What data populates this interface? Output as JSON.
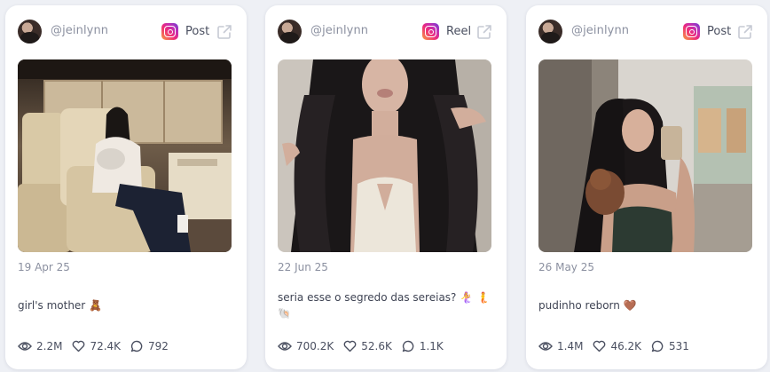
{
  "posts": [
    {
      "username": "@jeinlynn",
      "type": "Post",
      "date": "19 Apr 25",
      "caption": "girl's mother 🧸",
      "views": "2.2M",
      "likes": "72.4K",
      "comments": "792"
    },
    {
      "username": "@jeinlynn",
      "type": "Reel",
      "date": "22 Jun 25",
      "caption": "seria esse o segredo das sereias? 🧜‍♀️ 🧜 🐚",
      "views": "700.2K",
      "likes": "52.6K",
      "comments": "1.1K"
    },
    {
      "username": "@jeinlynn",
      "type": "Post",
      "date": "26 May 25",
      "caption": "pudinho reborn 🤎",
      "views": "1.4M",
      "likes": "46.2K",
      "comments": "531"
    }
  ],
  "icons": {
    "platform": "instagram-icon",
    "external": "external-link-icon",
    "views": "eye-icon",
    "likes": "heart-icon",
    "comments": "comment-icon"
  },
  "colors": {
    "page_background": "#eef0f5",
    "muted_text": "#8b90a0",
    "body_text": "#3f4454"
  }
}
